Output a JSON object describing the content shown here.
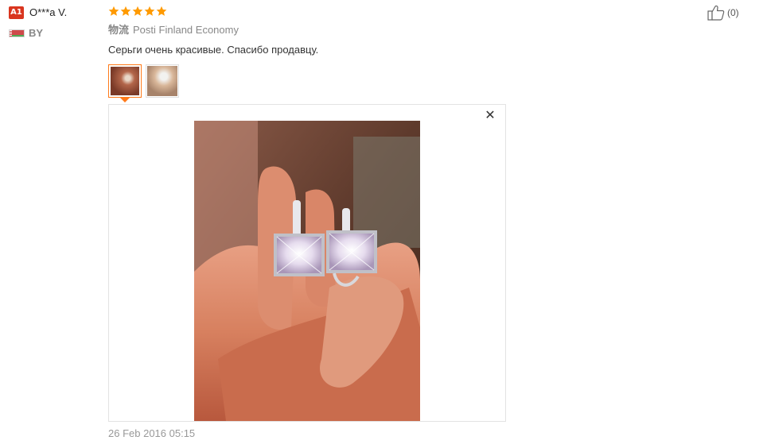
{
  "reviewer": {
    "badge": "A1",
    "name": "O***a V.",
    "country": "BY"
  },
  "rating": {
    "stars": 5,
    "max": 5,
    "color": "#ff9a00"
  },
  "shipping": {
    "label": "物流",
    "method": "Posti Finland Economy"
  },
  "review": {
    "text": "Серьги очень красивые. Спасибо продавцу."
  },
  "photos": {
    "count": 2,
    "selected_index": 0
  },
  "date": "26 Feb 2016 05:15",
  "helpful": {
    "count": "(0)"
  },
  "colors": {
    "accent": "#ff7a1a",
    "badge": "#d9351f",
    "muted": "#999999"
  }
}
